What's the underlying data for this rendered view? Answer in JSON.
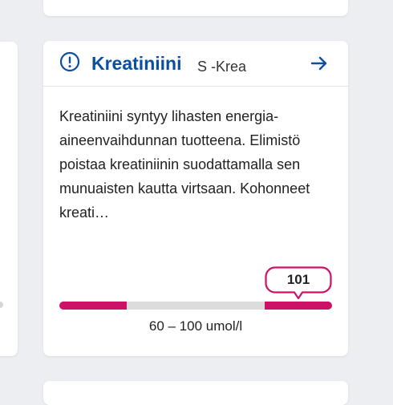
{
  "card": {
    "title": "Kreatiniini",
    "abbreviation": "S -Krea",
    "description": "Kreatiniini syntyy lihasten energia­aineenvaihdunnan tuotteena. Elimistö poistaa kreatiniinin suodattamalla sen munuaisten kautta virtsaan. Kohonneet kreati…",
    "status_icon": "alert-circle-icon",
    "link_icon": "arrow-right-icon"
  },
  "result": {
    "value": "101",
    "value_number": 101,
    "reference_range": "60 – 100 umol/l",
    "reference_min": 60,
    "reference_max": 100,
    "unit": "umol/l",
    "status": "high"
  },
  "colors": {
    "brand_blue": "#0b4fa1",
    "alert_magenta": "#cc1166",
    "track_gray": "#dcdcdc"
  }
}
